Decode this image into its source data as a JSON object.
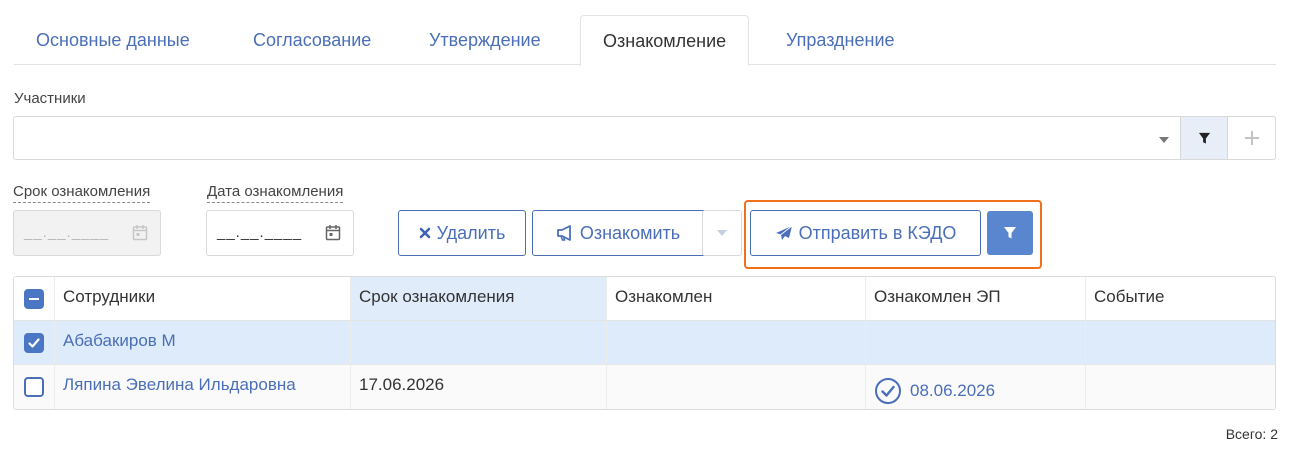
{
  "tabs": [
    {
      "label": "Основные данные",
      "active": false
    },
    {
      "label": "Согласование",
      "active": false
    },
    {
      "label": "Утверждение",
      "active": false
    },
    {
      "label": "Ознакомление",
      "active": true
    },
    {
      "label": "Упразднение",
      "active": false
    }
  ],
  "participants": {
    "label": "Участники",
    "value": ""
  },
  "deadline": {
    "label": "Срок ознакомления",
    "placeholder": "__.__.____",
    "disabled": true
  },
  "ack_date": {
    "label": "Дата ознакомления",
    "placeholder": "__.__.____"
  },
  "toolbar": {
    "delete_label": "Удалить",
    "acquaint_label": "Ознакомить",
    "send_label": "Отправить в КЭДО"
  },
  "table": {
    "columns": [
      "Сотрудники",
      "Срок ознакомления",
      "Ознакомлен",
      "Ознакомлен ЭП",
      "Событие"
    ],
    "rows": [
      {
        "checked": true,
        "employee": "Абабакиров М",
        "deadline": "",
        "acquainted": "",
        "acquainted_ep": "",
        "event": ""
      },
      {
        "checked": false,
        "employee": "Ляпина Эвелина Ильдаровна",
        "deadline": "17.06.2026",
        "acquainted": "",
        "acquainted_ep": "08.06.2026",
        "event": ""
      }
    ]
  },
  "footer": {
    "total": "Всего: 2"
  },
  "colors": {
    "accent": "#4a6fb8",
    "highlight": "#f0701e",
    "selected_row": "#ddebfa",
    "filter_button": "#5a86cf"
  },
  "icons": [
    "filter-icon",
    "plus-icon",
    "calendar-icon",
    "times-icon",
    "bullhorn-icon",
    "paper-plane-icon",
    "check-circle-icon"
  ]
}
